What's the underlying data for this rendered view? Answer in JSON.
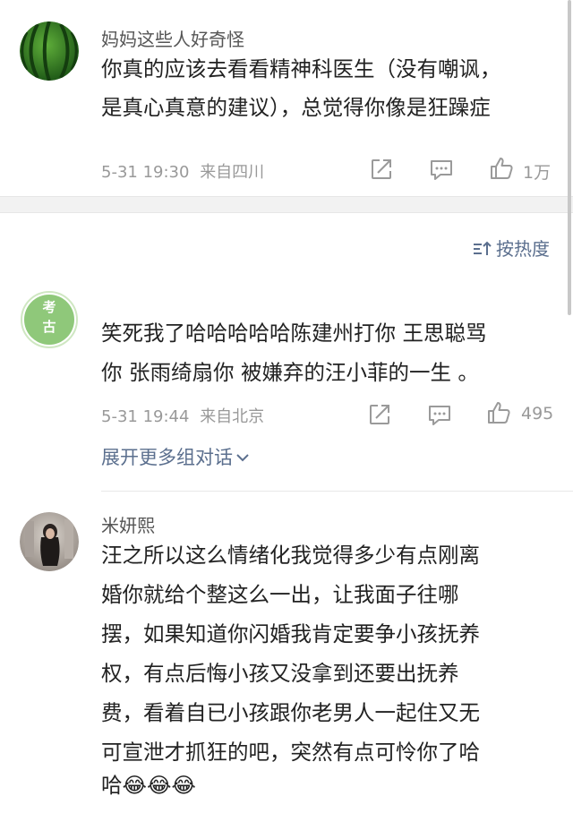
{
  "comments": [
    {
      "username": "妈妈这些人好奇怪",
      "lines": [
        "你真的应该去看看精神科医生（没有嘲讽，",
        "是真心真意的建议），总觉得你像是狂躁症"
      ],
      "time": "5-31 19:30",
      "location": "来自四川",
      "likes": "1万",
      "avatar_icon": "watermelon-icon"
    },
    {
      "username": "",
      "lines": [
        "笑死我了哈哈哈哈哈陈建州打你 王思聪骂",
        "你 张雨绮扇你 被嫌弃的汪小菲的一生 。"
      ],
      "time": "5-31 19:44",
      "location": "来自北京",
      "likes": "495",
      "avatar_text": "考古",
      "expand_label": "展开更多组对话"
    },
    {
      "username": "米妍熙",
      "lines": [
        "汪之所以这么情绪化我觉得多少有点刚离",
        "婚你就给个整这么一出，让我面子往哪",
        "摆，如果知道你闪婚我肯定要争小孩抚养",
        "权，有点后悔小孩又没拿到还要出抚养",
        "费，看着自已小孩跟你老男人一起住又无",
        "可宣泄才抓狂的吧，突然有点可怜你了哈",
        "哈😂😂😂"
      ],
      "avatar_icon": "user-photo-avatar"
    }
  ],
  "sort_label": "按热度",
  "colors": {
    "link": "#5b6f8e",
    "meta": "#999999",
    "badge": "#8fc87a"
  }
}
